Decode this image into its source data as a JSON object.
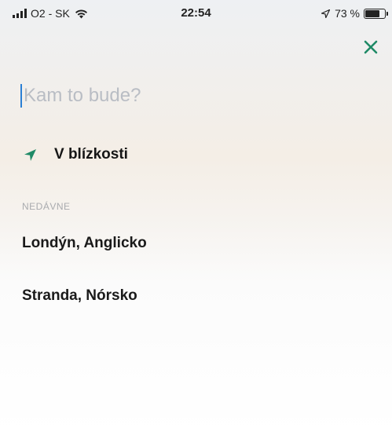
{
  "status_bar": {
    "carrier": "O2 - SK",
    "time": "22:54",
    "battery": "73 %",
    "battery_level": 0.73
  },
  "search": {
    "placeholder": "Kam to bude?",
    "value": ""
  },
  "nearby": {
    "label": "V blízkosti",
    "icon": "location-arrow-icon"
  },
  "recent": {
    "header": "NEDÁVNE",
    "items": [
      {
        "label": "Londýn, Anglicko"
      },
      {
        "label": "Stranda, Nórsko"
      }
    ]
  },
  "colors": {
    "accent": "#1f8a66",
    "caret": "#2a7fd4"
  }
}
